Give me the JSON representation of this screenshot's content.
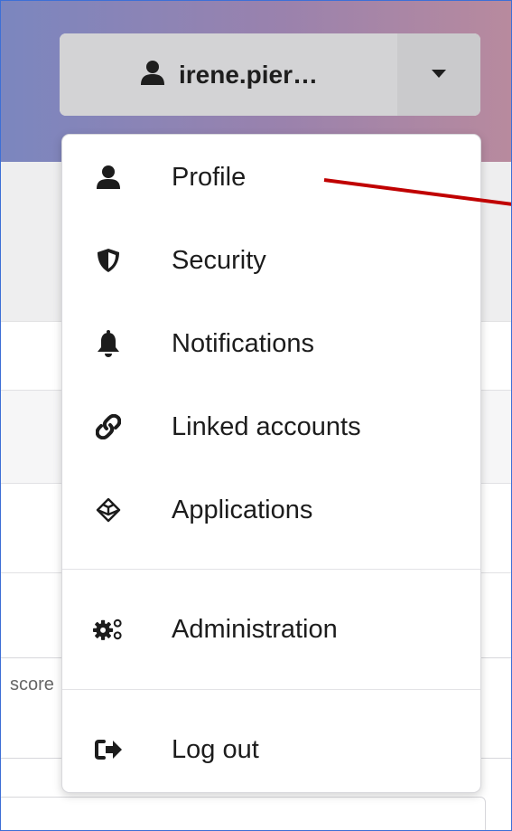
{
  "user_menu": {
    "username": "irene.pier…",
    "avatar_icon": "user-icon",
    "toggle_icon": "caret-down-icon"
  },
  "dropdown": {
    "items": [
      {
        "label": "Profile",
        "icon": "user-icon"
      },
      {
        "label": "Security",
        "icon": "shield-icon"
      },
      {
        "label": "Notifications",
        "icon": "bell-icon"
      },
      {
        "label": "Linked accounts",
        "icon": "link-icon"
      },
      {
        "label": "Applications",
        "icon": "cube-icon"
      },
      {
        "label": "Administration",
        "icon": "gears-icon"
      },
      {
        "label": "Log out",
        "icon": "sign-out-icon"
      }
    ]
  },
  "background": {
    "partial_label": "score"
  },
  "colors": {
    "header_gradient_start": "#7b86bf",
    "header_gradient_end": "#b88a9e",
    "annotation_arrow": "#c00000",
    "frame_border": "#3d6fd6"
  }
}
